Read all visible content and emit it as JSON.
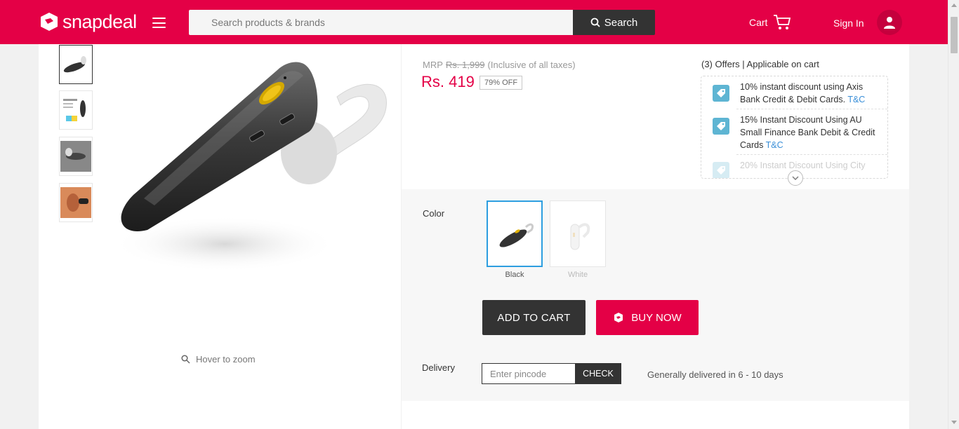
{
  "header": {
    "logo_text": "snapdeal",
    "search_placeholder": "Search products & brands",
    "search_button": "Search",
    "cart_label": "Cart",
    "signin_label": "Sign In",
    "brand_color": "#e40046"
  },
  "gallery": {
    "thumbnails": [
      "headset-black",
      "product-info-card",
      "headset-grey",
      "ear-worn"
    ],
    "active_index": 0,
    "zoom_hint": "Hover to zoom"
  },
  "pricing": {
    "mrp_label": "MRP",
    "mrp_value": "Rs. 1,999",
    "tax_note": "(Inclusive of all taxes)",
    "price": "Rs. 419",
    "discount": "79% OFF"
  },
  "offers": {
    "title": "(3) Offers | Applicable on cart",
    "items": [
      {
        "text": "10% instant discount using Axis Bank Credit & Debit Cards.",
        "link": "T&C"
      },
      {
        "text": "15% Instant Discount Using AU Small Finance Bank Debit & Credit Cards",
        "link": "T&C"
      },
      {
        "text": "20% Instant Discount Using City",
        "link": ""
      }
    ]
  },
  "color": {
    "label": "Color",
    "options": [
      {
        "name": "Black",
        "selected": true
      },
      {
        "name": "White",
        "selected": false
      }
    ]
  },
  "actions": {
    "add_to_cart": "ADD TO CART",
    "buy_now": "BUY NOW"
  },
  "delivery": {
    "label": "Delivery",
    "pincode_placeholder": "Enter pincode",
    "check_button": "CHECK",
    "info": "Generally delivered in 6 - 10 days"
  }
}
